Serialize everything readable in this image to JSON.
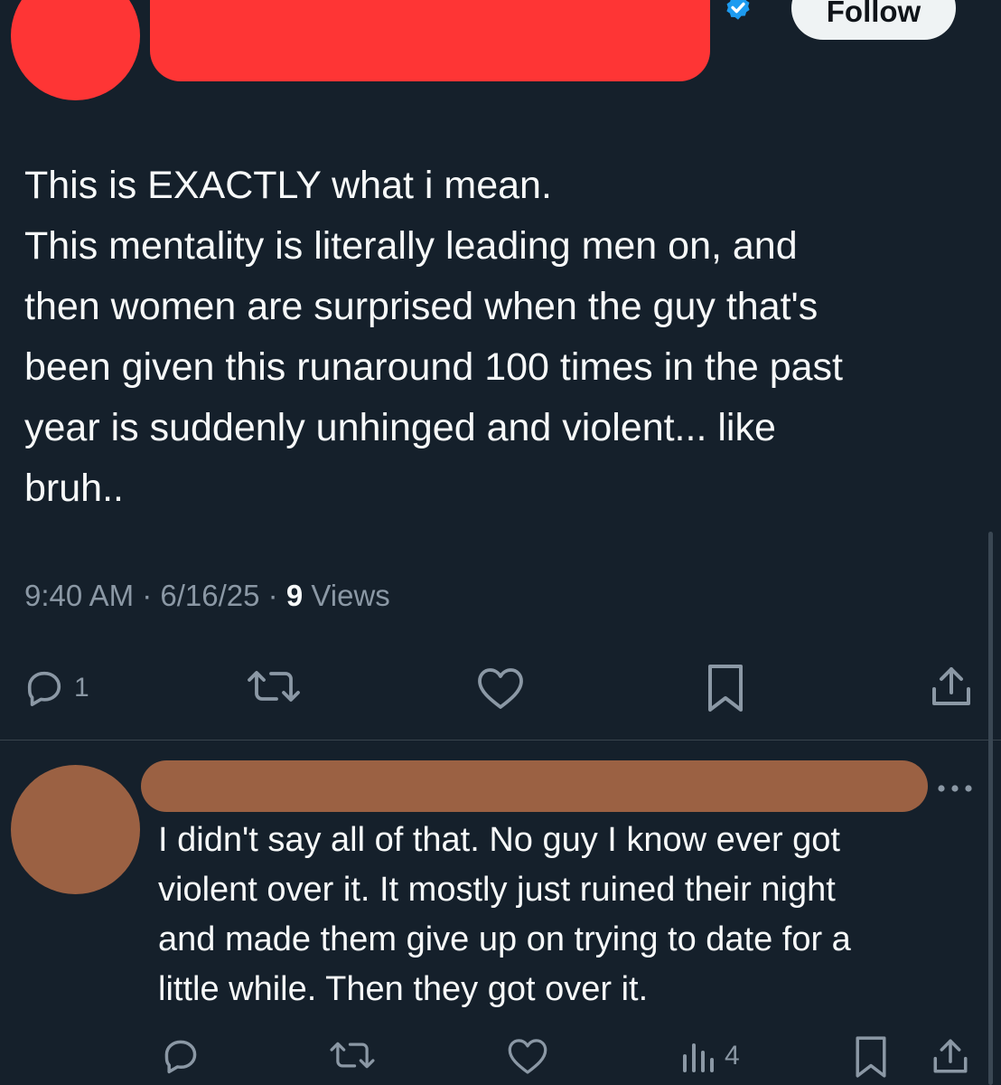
{
  "main_tweet": {
    "follow_label": "Follow",
    "text_lines": [
      "This is EXACTLY what i mean.",
      "This mentality is literally leading men on, and",
      "then women are surprised when the guy that's",
      "been given this runaround 100 times in the past",
      "year is suddenly unhinged and violent... like",
      "bruh.."
    ],
    "time": "9:40 AM",
    "date": "6/16/25",
    "separator": " · ",
    "views_count": "9",
    "views_label": "Views",
    "actions": {
      "reply_count": "1"
    }
  },
  "reply_tweet": {
    "text_lines": [
      "I didn't say all of that. No guy I know ever got",
      "violent over it. It mostly just ruined their night",
      "and made them give up on trying to date for a",
      "little while. Then they got over it."
    ],
    "actions": {
      "views_count": "4"
    }
  },
  "colors": {
    "background": "#15202b",
    "text": "#f7f9f9",
    "muted": "#8b98a5",
    "verified": "#1d9bf0",
    "redaction_red": "#fe3535",
    "redaction_brown": "#9b6143"
  },
  "icons": [
    "verified-badge-icon",
    "reply-icon",
    "retweet-icon",
    "like-icon",
    "bookmark-icon",
    "share-icon",
    "views-icon",
    "more-icon"
  ]
}
